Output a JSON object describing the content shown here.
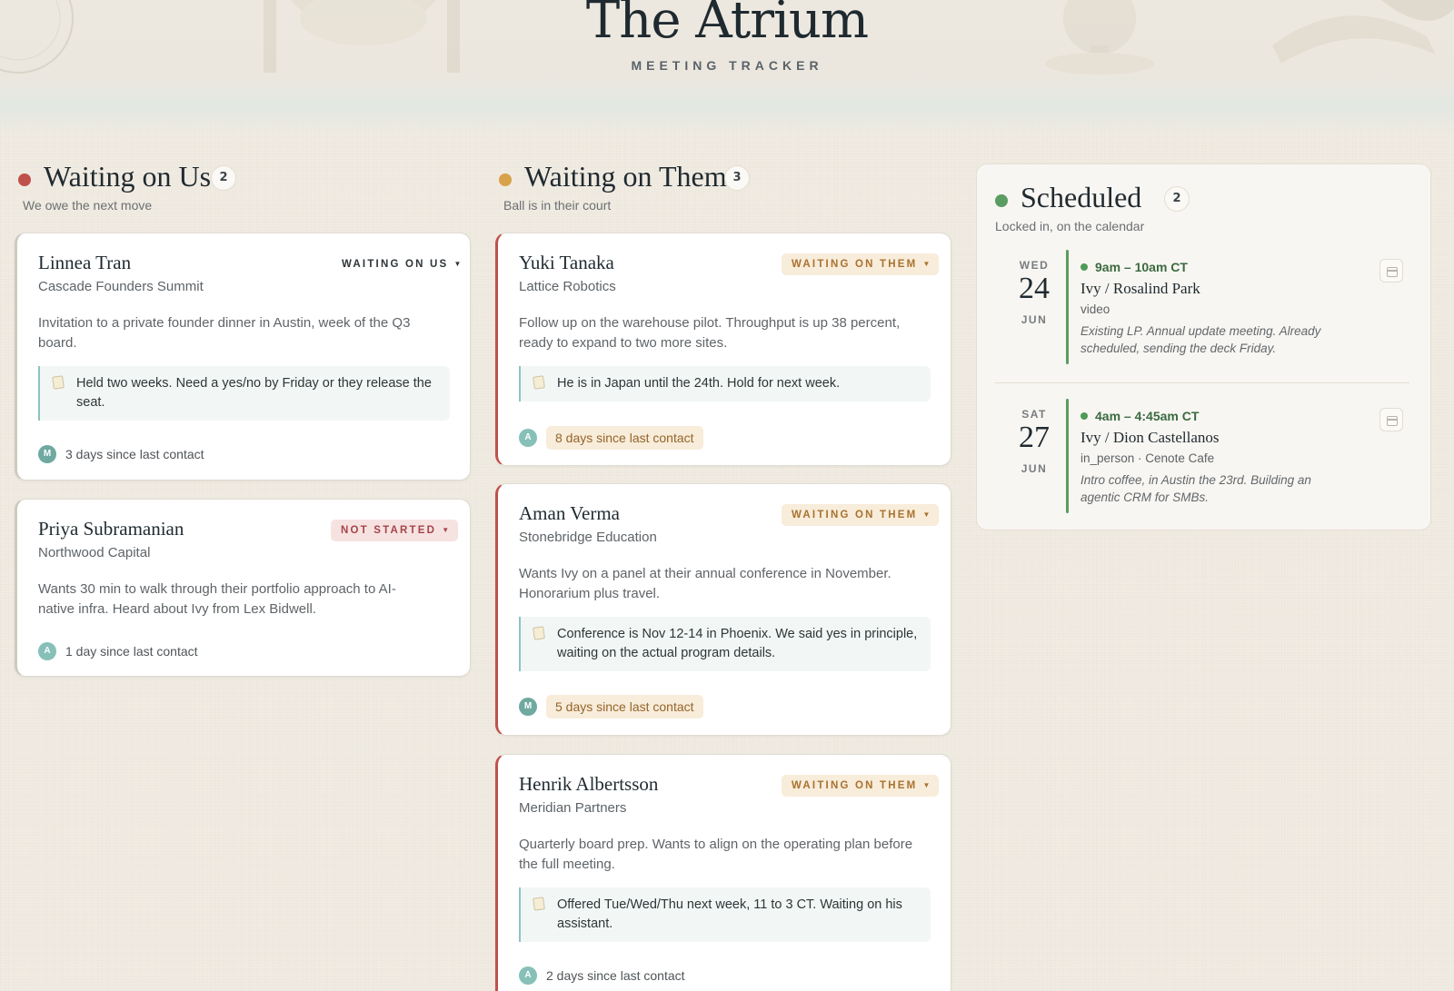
{
  "header": {
    "title": "The Atrium",
    "subtitle": "MEETING TRACKER"
  },
  "colors": {
    "waiting_on_us": "#c0514a",
    "waiting_on_them": "#d8a24a",
    "scheduled": "#5a9c61"
  },
  "columns": [
    {
      "title": "Waiting on Us",
      "count": "2",
      "description": "We owe the next move",
      "cards": [
        {
          "name": "Linnea Tran",
          "org": "Cascade Founders Summit",
          "status": "WAITING ON US",
          "summary": "Invitation to a private founder dinner in Austin, week of the Q3 board.",
          "note": "Held two weeks. Need a yes/no by Friday or they release the seat.",
          "avatar": "M",
          "contact": "3 days since last contact"
        },
        {
          "name": "Priya Subramanian",
          "org": "Northwood Capital",
          "status": "NOT STARTED",
          "summary": "Wants 30 min to walk through their portfolio approach to AI-native infra. Heard about Ivy from Lex Bidwell.",
          "avatar": "A",
          "contact": "1 day since last contact"
        }
      ]
    },
    {
      "title": "Waiting on Them",
      "count": "3",
      "description": "Ball is in their court",
      "cards": [
        {
          "name": "Yuki Tanaka",
          "org": "Lattice Robotics",
          "status": "WAITING ON THEM",
          "summary": "Follow up on the warehouse pilot. Throughput is up 38 percent, ready to expand to two more sites.",
          "note": "He is in Japan until the 24th. Hold for next week.",
          "avatar": "A",
          "contact": "8 days since last contact"
        },
        {
          "name": "Aman Verma",
          "org": "Stonebridge Education",
          "status": "WAITING ON THEM",
          "summary": "Wants Ivy on a panel at their annual conference in November. Honorarium plus travel.",
          "note": "Conference is Nov 12-14 in Phoenix. We said yes in principle, waiting on the actual program details.",
          "avatar": "M",
          "contact": "5 days since last contact"
        },
        {
          "name": "Henrik Albertsson",
          "org": "Meridian Partners",
          "status": "WAITING ON THEM",
          "summary": "Quarterly board prep. Wants to align on the operating plan before the full meeting.",
          "note": "Offered Tue/Wed/Thu next week, 11 to 3 CT. Waiting on his assistant.",
          "avatar": "A",
          "contact": "2 days since last contact"
        }
      ]
    },
    {
      "title": "Scheduled",
      "count": "2",
      "description": "Locked in, on the calendar",
      "events": [
        {
          "dow": "WED",
          "day": "24",
          "month": "JUN",
          "time": "9am – 10am CT",
          "who": "Ivy / Rosalind Park",
          "where": "video",
          "notes": "Existing LP. Annual update meeting. Already scheduled, sending the deck Friday."
        },
        {
          "dow": "SAT",
          "day": "27",
          "month": "JUN",
          "time": "4am – 4:45am CT",
          "who": "Ivy / Dion Castellanos",
          "where": "in_person · Cenote Cafe",
          "notes": "Intro coffee, in Austin the 23rd. Building an agentic CRM for SMBs."
        }
      ]
    }
  ]
}
